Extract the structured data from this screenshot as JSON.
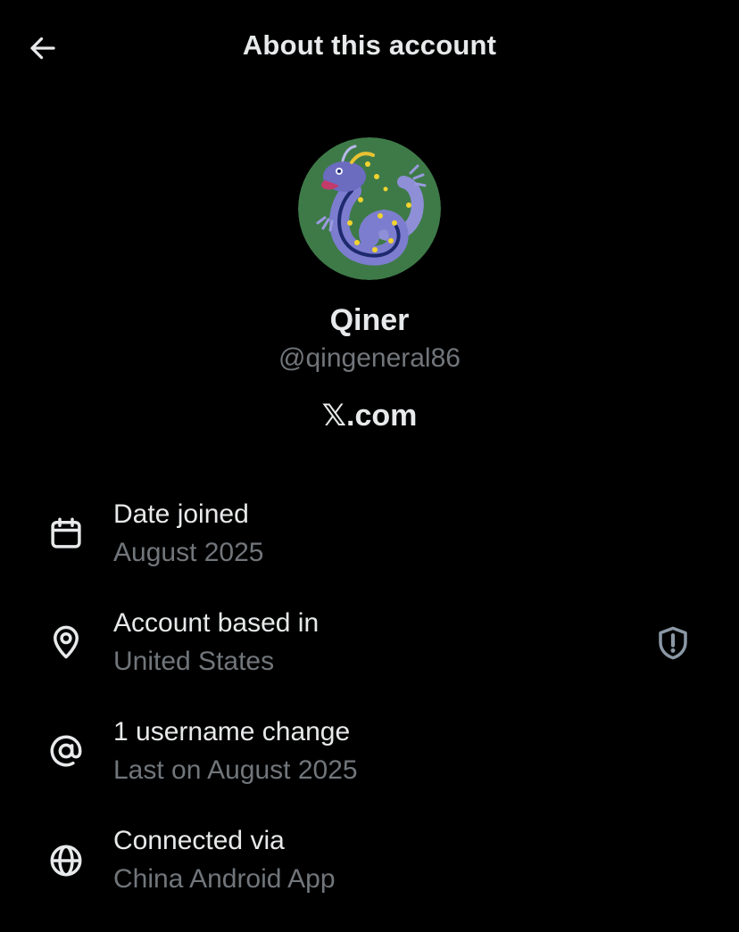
{
  "header": {
    "title": "About this account",
    "back_icon": "arrow-left-icon"
  },
  "profile": {
    "display_name": "Qiner",
    "handle": "@qingeneral86",
    "platform": "𝕏.com",
    "avatar_icon": "dragon-avatar"
  },
  "rows": [
    {
      "icon": "calendar-icon",
      "label": "Date joined",
      "value": "August 2025"
    },
    {
      "icon": "location-pin-icon",
      "label": "Account based in",
      "value": "United States",
      "action_icon": "shield-alert-icon"
    },
    {
      "icon": "at-sign-icon",
      "label": "1 username change",
      "value": "Last on August 2025"
    },
    {
      "icon": "globe-icon",
      "label": "Connected via",
      "value": "China Android App"
    }
  ],
  "colors": {
    "background": "#000000",
    "primary_text": "#e7e9ea",
    "secondary_text": "#71767b"
  }
}
